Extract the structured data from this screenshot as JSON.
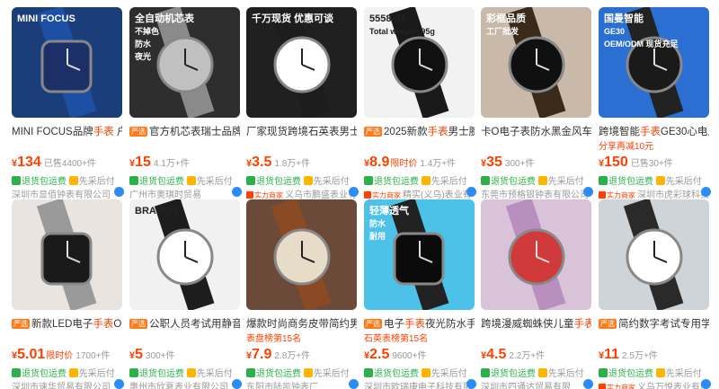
{
  "colors": {
    "price": "#ff4000",
    "green": "#2bb04a",
    "muted": "#999999",
    "chat": "#2c8cf5"
  },
  "row1": [
    {
      "title_pre": "MINI FOCUS品牌",
      "title_hl": "手表",
      "title_post": " 户外",
      "yx": "",
      "sub": "",
      "price_pre": "¥",
      "price": "134",
      "badge": "",
      "sold": "已售4400+件",
      "svc": "退货包运费",
      "svc2": "先采后付",
      "shoptag": "",
      "shop": "深圳市显佰钟表有限公司",
      "overlay": [
        "MINI FOCUS"
      ]
    },
    {
      "title_pre": "官方机芯表瑞士品牌男",
      "title_hl": "",
      "title_post": "",
      "yx": "严选",
      "sub": "",
      "price_pre": "¥",
      "price": "15",
      "badge": "",
      "sold": "4.1万+件",
      "svc": "退货包运费",
      "svc2": "先采后付",
      "shoptag": "",
      "shop": "广州市奥琪时贸易",
      "overlay": [
        "全自动机芯表",
        "不掉色",
        "防水",
        "夜光"
      ]
    },
    {
      "title_pre": "厂家现货跨境石英表男士",
      "title_hl": "手",
      "title_post": "",
      "yx": "",
      "sub": "",
      "price_pre": "¥",
      "price": "3.5",
      "badge": "",
      "sold": "1.8万+件",
      "svc": "退货包运费",
      "svc2": "先采后付",
      "shoptag": "实力商家",
      "shop": "义乌市鹏盛表业有限",
      "overlay": [
        "千万现货 优惠可谈"
      ]
    },
    {
      "title_pre": "2025新款",
      "title_hl": "手表",
      "title_post": "男士腕表阿拉",
      "yx": "严选",
      "sub": "",
      "price_pre": "¥",
      "price": "8.9",
      "badge": "限时价",
      "sold": "1.4万+件",
      "svc": "退货包运费",
      "svc2": "先采后付",
      "shoptag": "实力商家",
      "shop": "精实(义乌)表业有",
      "overlay": [
        "5558-01",
        "Total weight: 95g"
      ]
    },
    {
      "title_pre": "卡O电子表防水黑金风车学",
      "title_hl": "",
      "title_post": "",
      "yx": "",
      "sub": "",
      "price_pre": "¥",
      "price": "35",
      "badge": "",
      "sold": "300+件",
      "svc": "退货包运费",
      "svc2": "先采后付",
      "shoptag": "",
      "shop": "东莞市预格银钟表有限公司",
      "overlay": [
        "彩框品质",
        "工厂批发"
      ]
    },
    {
      "title_pre": "跨境智能",
      "title_hl": "手表",
      "title_post": "GE30心电血",
      "yx": "",
      "sub": "分享再减10元",
      "price_pre": "¥",
      "price": "150",
      "badge": "",
      "sold": "已售30+件",
      "svc": "退货包运费",
      "svc2": "先采后付",
      "shoptag": "实力商家",
      "shop": "深圳市虎彩球科技有限公司",
      "overlay": [
        "国曼智能",
        "GE30",
        "OEM/ODM 现货充足"
      ]
    }
  ],
  "row2": [
    {
      "title_pre": "新款LED电子",
      "title_hl": "手表",
      "title_post": "O7海",
      "yx": "严选",
      "sub": "",
      "price_pre": "¥",
      "price": "5.01",
      "badge": "限时价",
      "sold": "1700+件",
      "svc": "退货包运费",
      "svc2": "先采后付",
      "shoptag": "",
      "shop": "深圳市速华贸易有限公司",
      "overlay": []
    },
    {
      "title_pre": "公职人员考试用静音",
      "title_hl": "手",
      "title_post": "",
      "yx": "严选",
      "sub": "",
      "price_pre": "¥",
      "price": "5",
      "badge": "",
      "sold": "300+件",
      "svc": "退货包运费",
      "svc2": "先采后付",
      "shoptag": "",
      "shop": "惠州市欣夏表业有限公司",
      "overlay": [
        "BRANCO"
      ]
    },
    {
      "title_pre": "爆款时尚商务皮带简约男士",
      "title_hl": "",
      "title_post": "",
      "yx": "",
      "sub": "表盘榜第15名",
      "price_pre": "¥",
      "price": "7.9",
      "badge": "",
      "sold": "2.8万+件",
      "svc": "退货包运费",
      "svc2": "先采后付",
      "shoptag": "",
      "shop": "东阳市陆凯钟表厂",
      "overlay": []
    },
    {
      "title_pre": "电子",
      "title_hl": "手表",
      "title_post": "夜光防水手环",
      "yx": "严选",
      "sub": "石英表榜第15名",
      "price_pre": "¥",
      "price": "2.5",
      "badge": "",
      "sold": "9600+件",
      "svc": "退货包运费",
      "svc2": "先采后付",
      "shoptag": "",
      "shop": "深圳市欧瑞康电子科技有限",
      "overlay": [
        "轻薄透气",
        "防水",
        "耐用"
      ]
    },
    {
      "title_pre": "跨境漫威蜘蛛侠儿童",
      "title_hl": "手表",
      "title_post": "七",
      "yx": "",
      "sub": "",
      "price_pre": "¥",
      "price": "4.5",
      "badge": "",
      "sold": "2.2万+件",
      "svc": "退货包运费",
      "svc2": "先采后付",
      "shoptag": "",
      "shop": "深圳市四通达贸易有限",
      "overlay": []
    },
    {
      "title_pre": "简约数字考试专用学生",
      "title_hl": "",
      "title_post": "",
      "yx": "严选",
      "sub": "",
      "price_pre": "¥",
      "price": "11",
      "badge": "",
      "sold": "2.5万+件",
      "svc": "退货包运费",
      "svc2": "先采后付",
      "shoptag": "实力商家",
      "shop": "义乌万悦表业有限公司",
      "overlay": []
    }
  ]
}
